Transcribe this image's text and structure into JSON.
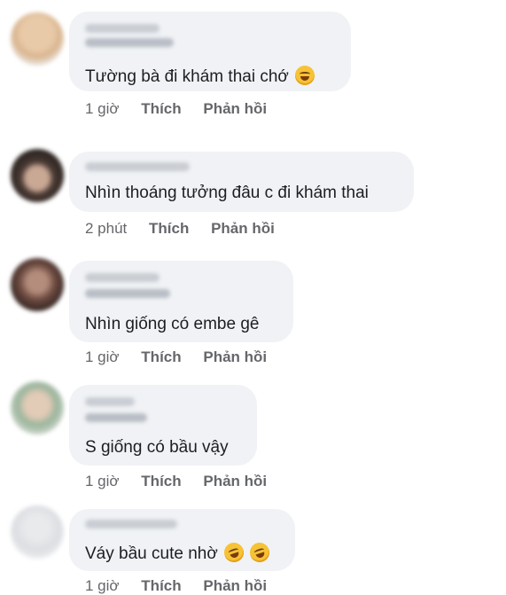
{
  "comments": [
    {
      "text": "Tường bà đi khám thai chớ",
      "emoji": "laughing-tears-emoji",
      "time": "1 giờ",
      "like_label": "Thích",
      "reply_label": "Phản hồi"
    },
    {
      "text": "Nhìn thoáng tưởng đâu c đi khám thai",
      "time": "2 phút",
      "like_label": "Thích",
      "reply_label": "Phản hồi"
    },
    {
      "text": "Nhìn giống có embe gê",
      "time": "1 giờ",
      "like_label": "Thích",
      "reply_label": "Phản hồi"
    },
    {
      "text": "S giống có bầu vậy",
      "time": "1 giờ",
      "like_label": "Thích",
      "reply_label": "Phản hồi"
    },
    {
      "text": "Váy bầu cute nhờ",
      "emoji": "rofl-emoji",
      "time": "1 giờ",
      "like_label": "Thích",
      "reply_label": "Phản hồi"
    }
  ],
  "colors": {
    "bubble": "#f0f2f5",
    "text": "#1c1e21",
    "meta": "#65676b"
  }
}
